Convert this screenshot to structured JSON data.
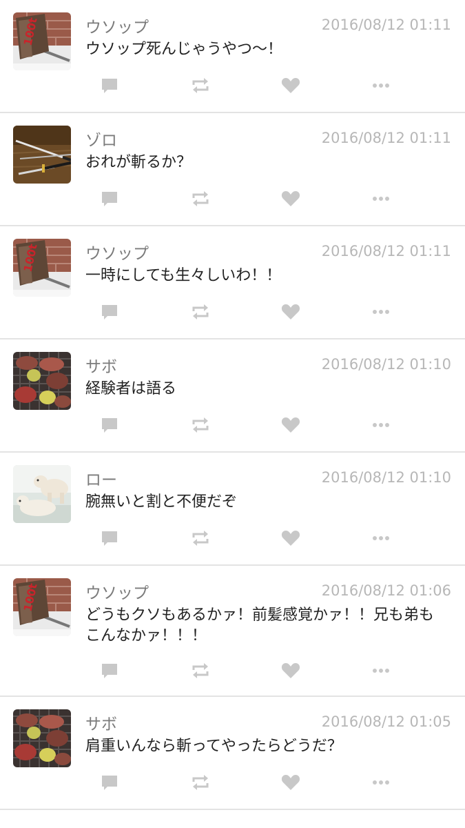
{
  "posts": [
    {
      "name": "ウソップ",
      "time": "2016/08/12 01:11",
      "text": "ウソップ死んじゃうやつ〜！",
      "avatar": "hammer-avatar"
    },
    {
      "name": "ゾロ",
      "time": "2016/08/12 01:11",
      "text": "おれが斬るか？",
      "avatar": "swords-avatar"
    },
    {
      "name": "ウソップ",
      "time": "2016/08/12 01:11",
      "text": "一時にしても生々しいわ！！",
      "avatar": "hammer-avatar"
    },
    {
      "name": "サボ",
      "time": "2016/08/12 01:10",
      "text": "経験者は語る",
      "avatar": "grill-avatar"
    },
    {
      "name": "ロー",
      "time": "2016/08/12 01:10",
      "text": "腕無いと割と不便だぞ",
      "avatar": "polar-bear-avatar"
    },
    {
      "name": "ウソップ",
      "time": "2016/08/12 01:06",
      "text": "どうもクソもあるかァ！前髪感覚かァ！！兄も弟もこんなかァ！！！",
      "avatar": "hammer-avatar"
    },
    {
      "name": "サボ",
      "time": "2016/08/12 01:05",
      "text": "肩重いんなら斬ってやったらどうだ？",
      "avatar": "grill-avatar"
    }
  ],
  "icons": {
    "reply": "speech-bubble-icon",
    "repost": "repost-icon",
    "like": "heart-icon",
    "more": "more-dots-icon"
  },
  "colors": {
    "icon": "#c8c8c8",
    "name": "#7b7b7b",
    "time": "#b7b7b7",
    "text": "#222222",
    "divider": "#e3e3e3"
  }
}
